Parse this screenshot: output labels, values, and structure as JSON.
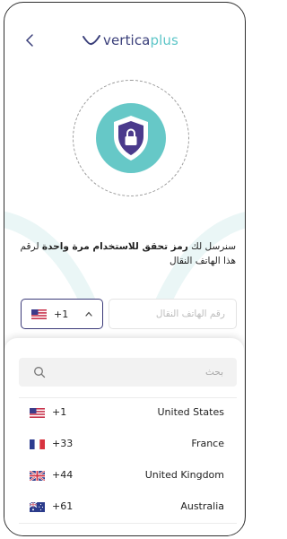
{
  "header": {
    "logo_part1": "vertica",
    "logo_part2": "plus"
  },
  "description": {
    "text_before": "سنرسل لك ",
    "text_bold": "رمز تحقق للاستخدام مرة واحدة",
    "text_after": " لرقم هذا الهاتف النقال"
  },
  "country_selector": {
    "selected_code": "+1",
    "selected_flag": "us-flag"
  },
  "phone_input": {
    "placeholder": "رقم الهاتف النقال",
    "value": ""
  },
  "dropdown": {
    "search_placeholder": "بحث",
    "countries": [
      {
        "code": "+1",
        "name": "United States",
        "flag": "us-flag"
      },
      {
        "code": "+33",
        "name": "France",
        "flag": "fr-flag"
      },
      {
        "code": "+44",
        "name": "United Kingdom",
        "flag": "gb-flag"
      },
      {
        "code": "+61",
        "name": "Australia",
        "flag": "au-flag"
      }
    ]
  },
  "colors": {
    "brand_dark": "#3a3f7a",
    "brand_teal": "#5ec6c8",
    "shield_purple": "#4a3a8c"
  }
}
